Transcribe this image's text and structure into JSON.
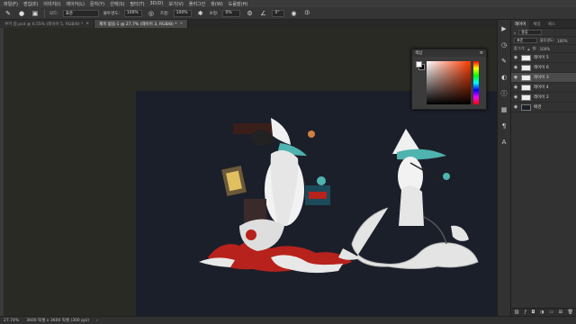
{
  "menu": [
    "파일(F)",
    "편집(E)",
    "이미지(I)",
    "레이어(L)",
    "문자(Y)",
    "선택(S)",
    "필터(T)",
    "3D(D)",
    "보기(V)",
    "플러그인",
    "창(W)",
    "도움말(H)"
  ],
  "options": {
    "mode_label": "모드:",
    "mode_value": "표준",
    "opacity_label": "불투명도:",
    "opacity_value": "100%",
    "flow_label": "흐름:",
    "flow_value": "100%",
    "smooth_label": "보정:",
    "smooth_value": "0%",
    "angle_value": "0°"
  },
  "tabs": [
    {
      "label": "쿠키 합.psd @ 6.55% (레이어 5, RGB/8) *",
      "active": false
    },
    {
      "label": "제목 없음-1 @ 27.7% (레이어 3, RGB/8) *",
      "active": true
    }
  ],
  "status": {
    "zoom": "27.74%",
    "doc": "3600 픽셀 x 3600 픽셀 (300 ppi)"
  },
  "color_panel": {
    "title": "색상",
    "foreground": "#ffffff",
    "background": "#000000",
    "base_hue": "#ff3a00"
  },
  "layers_panel": {
    "tabs": [
      "레이어",
      "채널",
      "패스"
    ],
    "kind_label": "종류",
    "blend_mode": "표준",
    "opacity_label": "불투명도:",
    "opacity_value": "100%",
    "lock_label": "잠그기:",
    "fill_label": "칠:",
    "fill_value": "100%",
    "layers": [
      {
        "name": "레이어 5",
        "selected": false
      },
      {
        "name": "레이어 6",
        "selected": false
      },
      {
        "name": "레이어 3",
        "selected": true
      },
      {
        "name": "레이어 4",
        "selected": false
      },
      {
        "name": "레이어 2",
        "selected": false
      },
      {
        "name": "배경",
        "selected": false
      }
    ]
  },
  "colors": {
    "canvas": "#1b1f2a",
    "workspace": "#2a2a25",
    "accent_teal": "#4fb3b0",
    "accent_red": "#b8221c"
  }
}
